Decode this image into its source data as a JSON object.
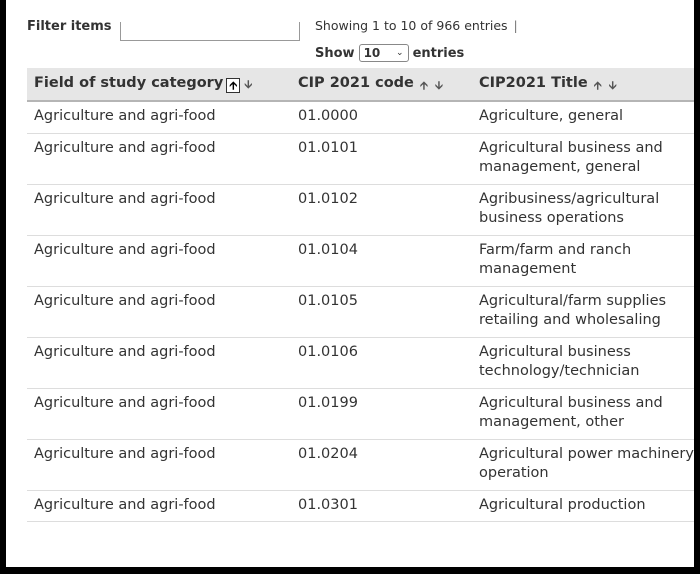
{
  "filter": {
    "label": "Filter items",
    "value": ""
  },
  "info": {
    "text": "Showing 1 to 10 of 966 entries",
    "separator": "|"
  },
  "length": {
    "prefix": "Show",
    "value": "10",
    "suffix": "entries"
  },
  "columns": [
    {
      "label": "Field of study category",
      "sort": "asc"
    },
    {
      "label": "CIP 2021 code",
      "sort": "none"
    },
    {
      "label": "CIP2021 Title",
      "sort": "none"
    }
  ],
  "rows": [
    {
      "category": "Agriculture and agri-food",
      "code": "01.0000",
      "title": "Agriculture, general"
    },
    {
      "category": "Agriculture and agri-food",
      "code": "01.0101",
      "title": "Agricultural business and management, general"
    },
    {
      "category": "Agriculture and agri-food",
      "code": "01.0102",
      "title": "Agribusiness/agricultural business operations"
    },
    {
      "category": "Agriculture and agri-food",
      "code": "01.0104",
      "title": "Farm/farm and ranch management"
    },
    {
      "category": "Agriculture and agri-food",
      "code": "01.0105",
      "title": "Agricultural/farm supplies retailing and wholesaling"
    },
    {
      "category": "Agriculture and agri-food",
      "code": "01.0106",
      "title": "Agricultural business technology/technician"
    },
    {
      "category": "Agriculture and agri-food",
      "code": "01.0199",
      "title": "Agricultural business and management, other"
    },
    {
      "category": "Agriculture and agri-food",
      "code": "01.0204",
      "title": "Agricultural power machinery operation"
    },
    {
      "category": "Agriculture and agri-food",
      "code": "01.0301",
      "title": "Agricultural production"
    }
  ]
}
